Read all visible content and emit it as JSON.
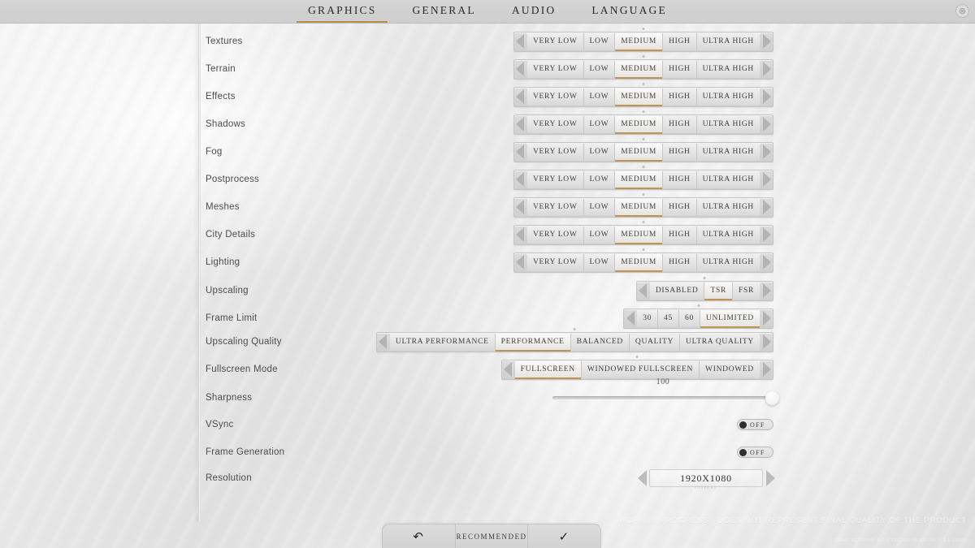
{
  "tabs": [
    {
      "label": "GRAPHICS",
      "active": true
    },
    {
      "label": "GENERAL",
      "active": false
    },
    {
      "label": "AUDIO",
      "active": false
    },
    {
      "label": "LANGUAGE",
      "active": false
    }
  ],
  "close_label": "⊗",
  "accent_color": "#bf9352",
  "background_color": "#e7e7e7",
  "settings": [
    {
      "label": "Textures",
      "type": "selector",
      "options": [
        "VERY LOW",
        "LOW",
        "MEDIUM",
        "HIGH",
        "ULTRA HIGH"
      ],
      "selected": 2
    },
    {
      "label": "Terrain",
      "type": "selector",
      "options": [
        "VERY LOW",
        "LOW",
        "MEDIUM",
        "HIGH",
        "ULTRA HIGH"
      ],
      "selected": 2
    },
    {
      "label": "Effects",
      "type": "selector",
      "options": [
        "VERY LOW",
        "LOW",
        "MEDIUM",
        "HIGH",
        "ULTRA HIGH"
      ],
      "selected": 2
    },
    {
      "label": "Shadows",
      "type": "selector",
      "options": [
        "VERY LOW",
        "LOW",
        "MEDIUM",
        "HIGH",
        "ULTRA HIGH"
      ],
      "selected": 2
    },
    {
      "label": "Fog",
      "type": "selector",
      "options": [
        "VERY LOW",
        "LOW",
        "MEDIUM",
        "HIGH",
        "ULTRA HIGH"
      ],
      "selected": 2
    },
    {
      "label": "Postprocess",
      "type": "selector",
      "options": [
        "VERY LOW",
        "LOW",
        "MEDIUM",
        "HIGH",
        "ULTRA HIGH"
      ],
      "selected": 2
    },
    {
      "label": "Meshes",
      "type": "selector",
      "options": [
        "VERY LOW",
        "LOW",
        "MEDIUM",
        "HIGH",
        "ULTRA HIGH"
      ],
      "selected": 2
    },
    {
      "label": "City Details",
      "type": "selector",
      "options": [
        "VERY LOW",
        "LOW",
        "MEDIUM",
        "HIGH",
        "ULTRA HIGH"
      ],
      "selected": 2
    },
    {
      "label": "Lighting",
      "type": "selector",
      "options": [
        "VERY LOW",
        "LOW",
        "MEDIUM",
        "HIGH",
        "ULTRA HIGH"
      ],
      "selected": 2
    },
    {
      "label": "Upscaling",
      "type": "selector",
      "options": [
        "DISABLED",
        "TSR",
        "FSR"
      ],
      "selected": 1
    },
    {
      "label": "Frame Limit",
      "type": "selector",
      "options": [
        "30",
        "45",
        "60",
        "UNLIMITED"
      ],
      "selected": 3
    },
    {
      "label": "Upscaling Quality",
      "type": "selector",
      "options": [
        "ULTRA PERFORMANCE",
        "PERFORMANCE",
        "BALANCED",
        "QUALITY",
        "ULTRA QUALITY"
      ],
      "selected": 1
    },
    {
      "label": "Fullscreen Mode",
      "type": "selector",
      "options": [
        "FULLSCREEN",
        "WINDOWED FULLSCREEN",
        "WINDOWED"
      ],
      "selected": 0
    },
    {
      "label": "Sharpness",
      "type": "slider",
      "value": "100",
      "percent": 100
    },
    {
      "label": "VSync",
      "type": "toggle",
      "state_label": "OFF",
      "on": false
    },
    {
      "label": "Frame Generation",
      "type": "toggle",
      "state_label": "OFF",
      "on": false
    },
    {
      "label": "Resolution",
      "type": "stepper",
      "value": "1920X1080",
      "sub_label": "DISPLAY"
    }
  ],
  "bottom_bar": {
    "back_glyph": "↶",
    "recommended_label": "RECOMMENDED",
    "confirm_glyph": "✓"
  },
  "watermark": {
    "wip": "WORK IN PROGRESS - DOES NOT REPRESENT FINAL QUALITY OF THE PRODUCT",
    "version": "GAME VERSION: 0.0.0 ENGINE VERSION: 5.3.1-28926"
  }
}
